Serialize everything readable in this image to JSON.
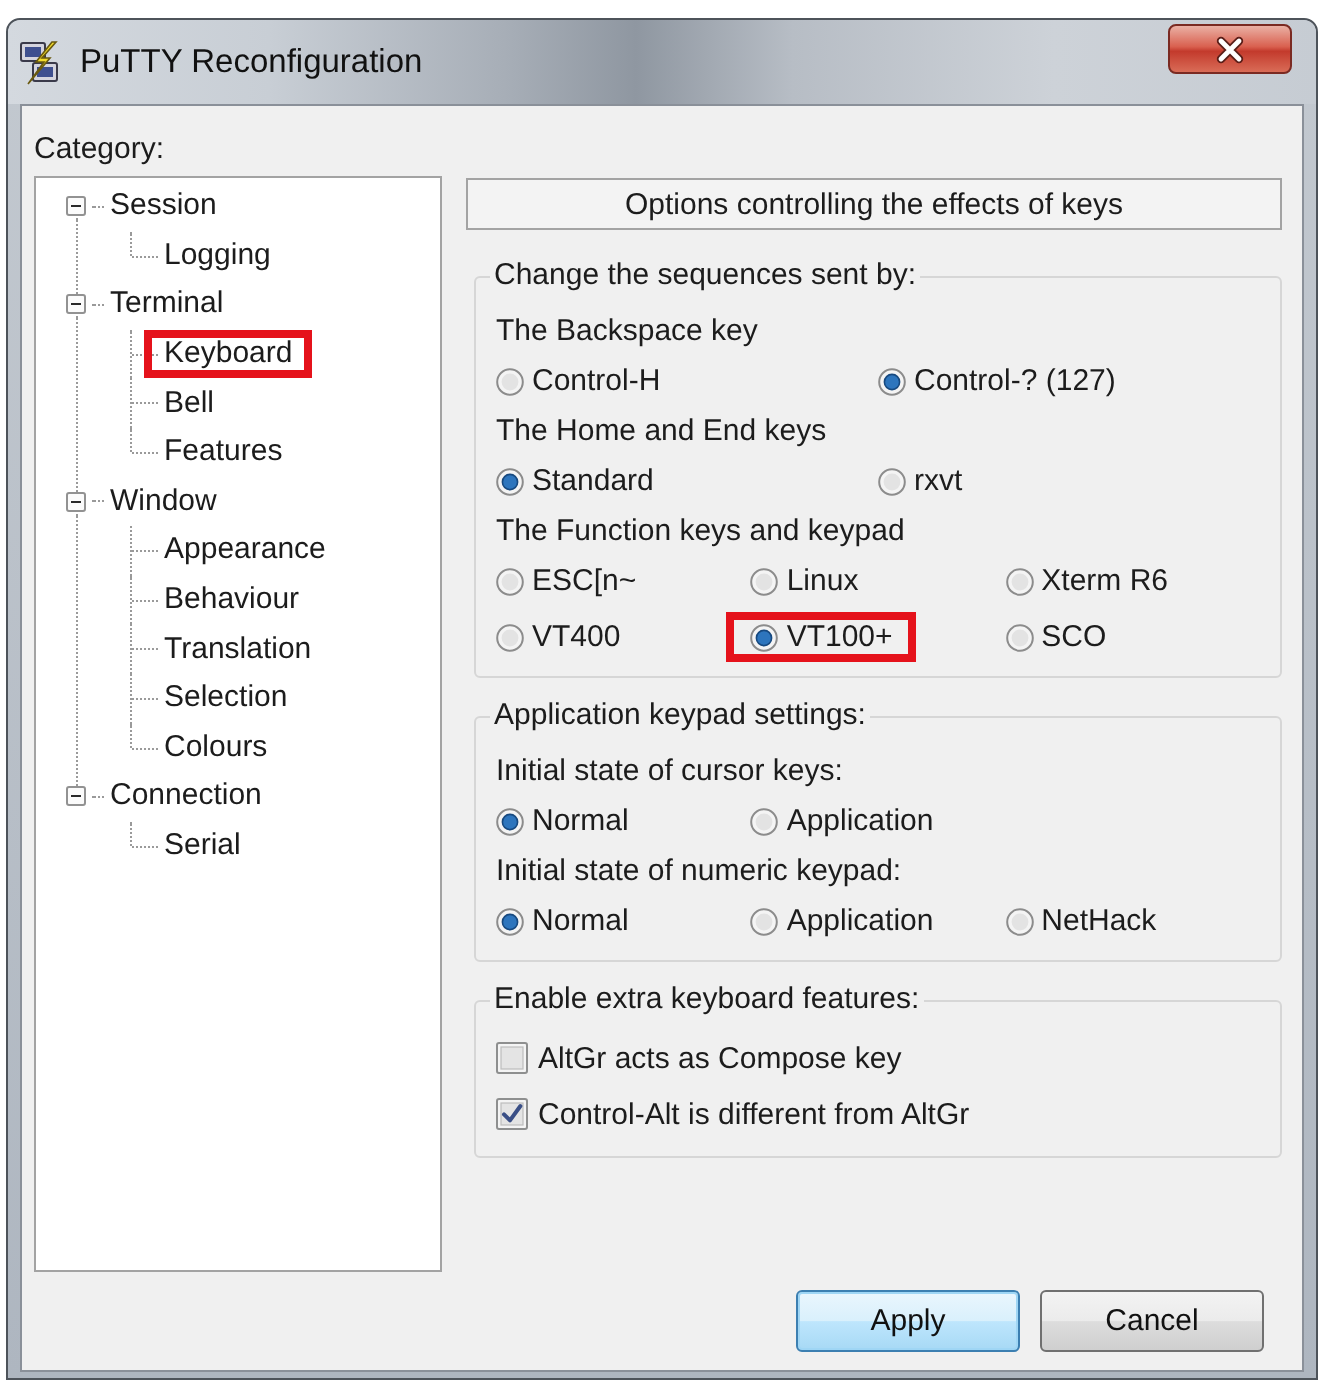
{
  "window": {
    "title": "PuTTY Reconfiguration"
  },
  "category": {
    "label": "Category:",
    "tree": [
      {
        "label": "Session",
        "expanded": true,
        "highlighted": false,
        "children": [
          {
            "label": "Logging",
            "highlighted": false
          }
        ]
      },
      {
        "label": "Terminal",
        "expanded": true,
        "highlighted": false,
        "children": [
          {
            "label": "Keyboard",
            "highlighted": true
          },
          {
            "label": "Bell",
            "highlighted": false
          },
          {
            "label": "Features",
            "highlighted": false
          }
        ]
      },
      {
        "label": "Window",
        "expanded": true,
        "highlighted": false,
        "children": [
          {
            "label": "Appearance",
            "highlighted": false
          },
          {
            "label": "Behaviour",
            "highlighted": false
          },
          {
            "label": "Translation",
            "highlighted": false
          },
          {
            "label": "Selection",
            "highlighted": false
          },
          {
            "label": "Colours",
            "highlighted": false
          }
        ]
      },
      {
        "label": "Connection",
        "expanded": true,
        "highlighted": false,
        "children": [
          {
            "label": "Serial",
            "highlighted": false
          }
        ]
      }
    ]
  },
  "panel": {
    "header": "Options controlling the effects of keys",
    "groups": [
      {
        "title": "Change the sequences sent by:",
        "settings": [
          {
            "kind": "radio",
            "label": "The Backspace key",
            "options": [
              {
                "label": "Control-H",
                "selected": false,
                "highlighted": false
              },
              {
                "label": "Control-? (127)",
                "selected": true,
                "highlighted": false
              }
            ]
          },
          {
            "kind": "radio",
            "label": "The Home and End keys",
            "options": [
              {
                "label": "Standard",
                "selected": true,
                "highlighted": false
              },
              {
                "label": "rxvt",
                "selected": false,
                "highlighted": false
              }
            ]
          },
          {
            "kind": "radio",
            "label": "The Function keys and keypad",
            "options": [
              {
                "label": "ESC[n~",
                "selected": false,
                "highlighted": false
              },
              {
                "label": "Linux",
                "selected": false,
                "highlighted": false
              },
              {
                "label": "Xterm R6",
                "selected": false,
                "highlighted": false
              },
              {
                "label": "VT400",
                "selected": false,
                "highlighted": false
              },
              {
                "label": "VT100+",
                "selected": true,
                "highlighted": true
              },
              {
                "label": "SCO",
                "selected": false,
                "highlighted": false
              }
            ]
          }
        ]
      },
      {
        "title": "Application keypad settings:",
        "settings": [
          {
            "kind": "radio",
            "label": "Initial state of cursor keys:",
            "options": [
              {
                "label": "Normal",
                "selected": true,
                "highlighted": false
              },
              {
                "label": "Application",
                "selected": false,
                "highlighted": false
              }
            ]
          },
          {
            "kind": "radio",
            "label": "Initial state of numeric keypad:",
            "options": [
              {
                "label": "Normal",
                "selected": true,
                "highlighted": false
              },
              {
                "label": "Application",
                "selected": false,
                "highlighted": false
              },
              {
                "label": "NetHack",
                "selected": false,
                "highlighted": false
              }
            ]
          }
        ]
      },
      {
        "title": "Enable extra keyboard features:",
        "settings": [
          {
            "kind": "checkbox",
            "label": "AltGr acts as Compose key",
            "checked": false
          },
          {
            "kind": "checkbox",
            "label": "Control-Alt is different from AltGr",
            "checked": true
          }
        ]
      }
    ]
  },
  "buttons": [
    {
      "label": "Apply",
      "default": true
    },
    {
      "label": "Cancel",
      "default": false
    }
  ]
}
